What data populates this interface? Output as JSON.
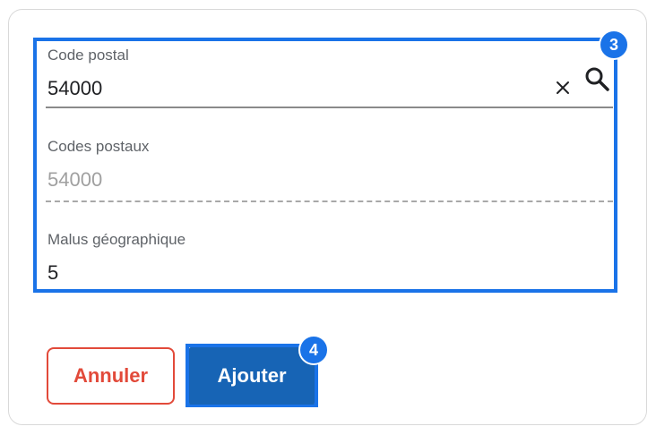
{
  "form": {
    "code_postal": {
      "label": "Code postal",
      "value": "54000"
    },
    "codes_postaux": {
      "label": "Codes postaux",
      "value": "54000"
    },
    "malus": {
      "label": "Malus géographique",
      "value": "5"
    }
  },
  "actions": {
    "cancel_label": "Annuler",
    "add_label": "Ajouter"
  },
  "annotations": {
    "form_badge": "3",
    "add_badge": "4"
  },
  "icons": {
    "clear": "close-icon",
    "search": "search-icon"
  },
  "colors": {
    "accent": "#1a73e8",
    "danger": "#e24a3a",
    "primary_button": "#1764b5"
  }
}
